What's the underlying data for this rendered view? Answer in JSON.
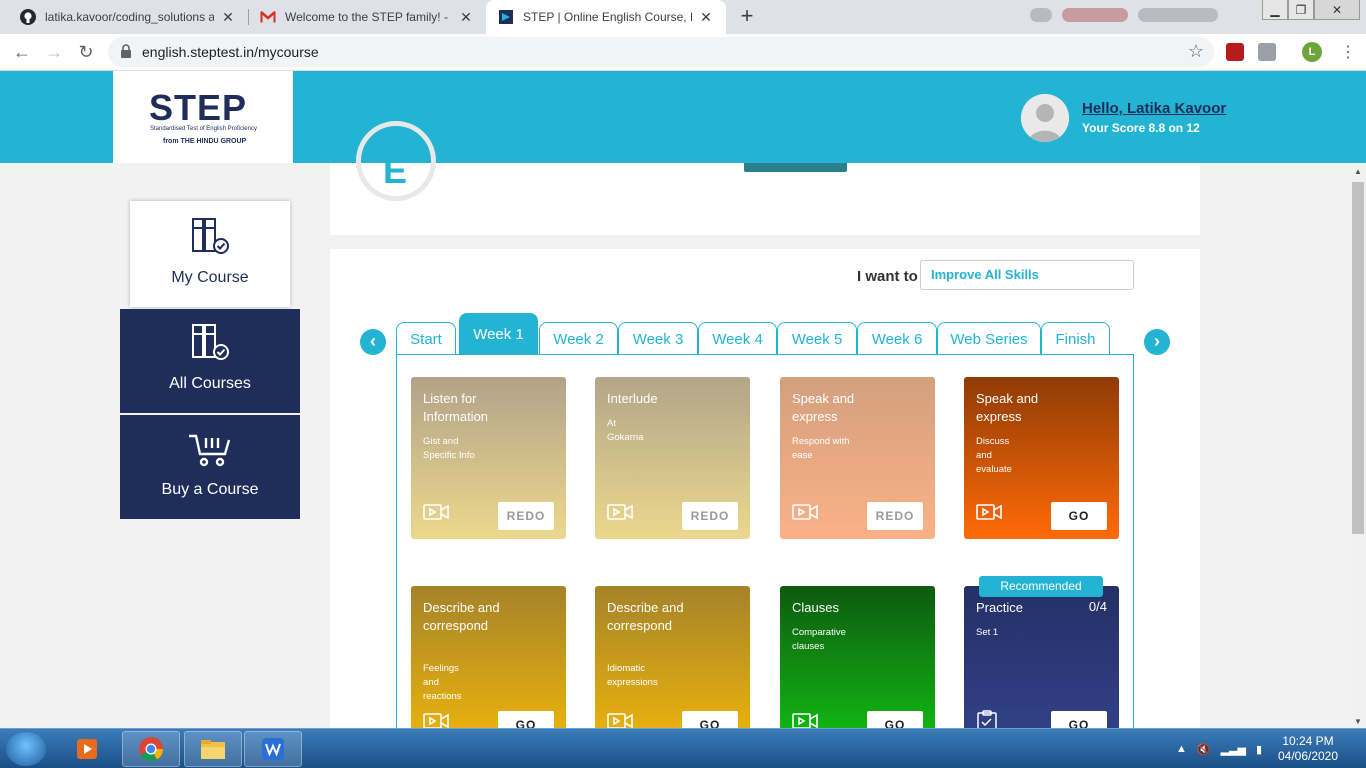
{
  "browser": {
    "tabs": [
      {
        "title": "latika.kavoor/coding_solutions at",
        "favicon": "github-icon",
        "active": false
      },
      {
        "title": "Welcome to the STEP family! - lat",
        "favicon": "gmail-icon",
        "active": false
      },
      {
        "title": "STEP | Online English Course, Eng",
        "favicon": "step-icon",
        "active": true
      }
    ],
    "url": "english.steptest.in/mycourse",
    "profile_initial": "L"
  },
  "header": {
    "logo_word": "STEP",
    "logo_sub": "Standardised Test of English Proficiency",
    "logo_from": "from THE HINDU GROUP",
    "greeting": "Hello, Latika Kavoor",
    "score": "Your Score 8.8 on 12"
  },
  "sidebar": {
    "items": [
      {
        "label": "My Course",
        "icon": "books-check-icon",
        "active": true
      },
      {
        "label": "All Courses",
        "icon": "books-check-icon",
        "active": false
      },
      {
        "label": "Buy a Course",
        "icon": "cart-icon",
        "active": false
      }
    ]
  },
  "top_card": {
    "badge_letter": "E"
  },
  "course": {
    "i_want_label": "I want to",
    "skill_value": "Improve All Skills",
    "tabs": [
      "Start",
      "Week 1",
      "Week 2",
      "Week 3",
      "Week 4",
      "Week 5",
      "Week 6",
      "Web Series",
      "Finish"
    ],
    "active_tab": "Week 1",
    "cards": [
      {
        "title": "Listen for Information",
        "subtitle": "Gist and Specific Info",
        "button": "REDO",
        "icon": "video-icon",
        "color": "#c4ae86"
      },
      {
        "title": "Interlude",
        "subtitle": "At Gokarna",
        "button": "REDO",
        "icon": "video-icon",
        "color": "#d1bf88"
      },
      {
        "title": "Speak and express",
        "subtitle": "Respond with ease",
        "button": "REDO",
        "icon": "video-icon",
        "color": "#ebaa82"
      },
      {
        "title": "Speak and express",
        "subtitle": "Discuss and evaluate",
        "button": "GO",
        "icon": "video-icon",
        "color": "#e05a10"
      },
      {
        "title": "Describe and correspond",
        "subtitle": "Feelings and reactions",
        "button": "GO",
        "icon": "video-icon",
        "color": "#c9a01c"
      },
      {
        "title": "Describe and correspond",
        "subtitle": "Idiomatic expressions",
        "button": "GO",
        "icon": "video-icon",
        "color": "#c9a01c"
      },
      {
        "title": "Clauses",
        "subtitle": "Comparative clauses",
        "button": "GO",
        "icon": "video-icon",
        "color": "#1a8a12"
      },
      {
        "title": "Practice",
        "subtitle": "Set 1",
        "button": "GO",
        "icon": "clipboard-icon",
        "color": "#2b3570",
        "badge": "Recommended",
        "count": "0/4"
      }
    ]
  },
  "taskbar": {
    "clock_time": "10:24 PM",
    "clock_date": "04/06/2020"
  }
}
